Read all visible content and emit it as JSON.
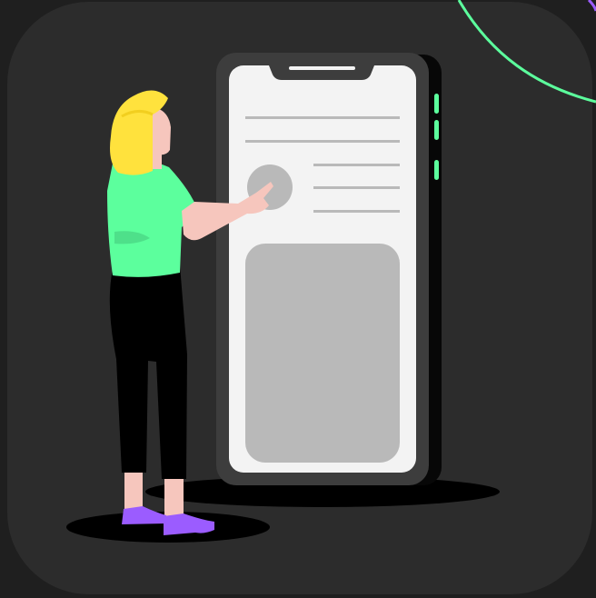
{
  "colors": {
    "page_background": "#1f1f1f",
    "tile_background": "#2c2c2c",
    "accent_green": "#5cff9d",
    "accent_purple": "#9b5cff",
    "hair_yellow": "#ffe23d",
    "skin": "#f6c6bd",
    "phone_frame": "#3d3d3d",
    "phone_screen": "#f3f3f3",
    "placeholder_gray": "#b9b9b9",
    "shadow": "#000000"
  },
  "icons": {
    "tile": "rounded-square-tile",
    "decor": "green-arc-decoration",
    "person": "woman-pointing-figure",
    "phone": "smartphone-mockup",
    "avatar": "avatar-placeholder-circle",
    "media": "image-placeholder-block"
  }
}
